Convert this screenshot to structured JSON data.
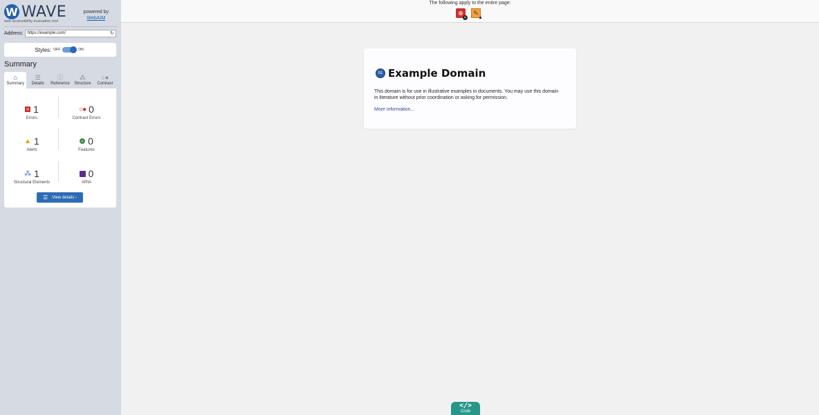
{
  "sidebar": {
    "logo": {
      "mark": "W",
      "name": "WAVE",
      "tagline": "web accessibility evaluation tool"
    },
    "powered_by": {
      "text": "powered by",
      "link": "WebAIM"
    },
    "address": {
      "label": "Address:",
      "value": "https://example.com/",
      "reload_icon": "reload-icon"
    },
    "styles": {
      "label": "Styles:",
      "off": "OFF",
      "on": "ON",
      "state": "on"
    },
    "summary_title": "Summary",
    "tabs": [
      {
        "label": "Summary",
        "icon": "home-icon",
        "active": true
      },
      {
        "label": "Details",
        "icon": "list-icon",
        "active": false
      },
      {
        "label": "Reference",
        "icon": "info-icon",
        "active": false
      },
      {
        "label": "Structure",
        "icon": "structure-icon",
        "active": false
      },
      {
        "label": "Contrast",
        "icon": "contrast-icon",
        "active": false
      }
    ],
    "stats": {
      "errors": {
        "count": "1",
        "label": "Errors"
      },
      "contrast_errors": {
        "count": "0",
        "label": "Contrast Errors"
      },
      "alerts": {
        "count": "1",
        "label": "Alerts"
      },
      "features": {
        "count": "0",
        "label": "Features"
      },
      "structural": {
        "count": "1",
        "label": "Structural Elements"
      },
      "aria": {
        "count": "0",
        "label": "ARIA"
      }
    },
    "view_details": "View details ›"
  },
  "topbar": {
    "text": "The following apply to the entire page:",
    "icons": [
      "language-missing-icon",
      "missing-title-icon"
    ]
  },
  "content": {
    "h1_badge": "h1",
    "heading": "Example Domain",
    "paragraph": "This domain is for use in illustrative examples in documents. You may use this domain in literature without prior coordination or asking for permission.",
    "link": "More information..."
  },
  "code_button": {
    "icon": "</>",
    "label": "Code"
  },
  "colors": {
    "sidebar_bg": "#d6dbe3",
    "accent": "#2a5fa6",
    "error": "#c9302c",
    "alert": "#e6a000",
    "feature": "#3a8a4e",
    "aria": "#5b2d8e",
    "code_button": "#27978a"
  }
}
